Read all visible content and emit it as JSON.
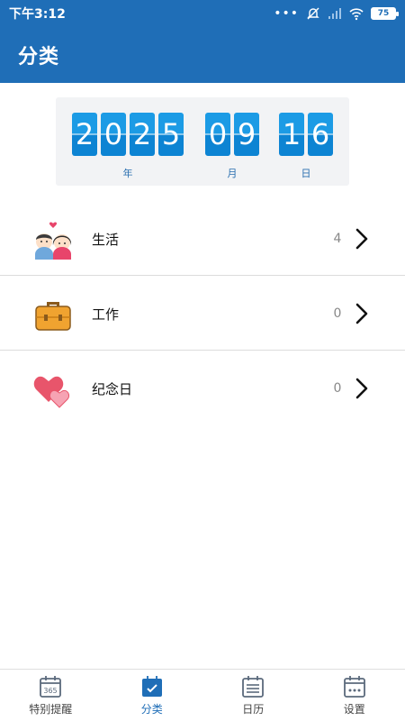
{
  "status_bar": {
    "time": "下午3:12",
    "battery": "75"
  },
  "header": {
    "title": "分类"
  },
  "date": {
    "year": [
      "2",
      "0",
      "2",
      "5"
    ],
    "month": [
      "0",
      "9"
    ],
    "day": [
      "1",
      "6"
    ],
    "year_label": "年",
    "month_label": "月",
    "day_label": "日"
  },
  "categories": [
    {
      "label": "生活",
      "count": "4",
      "icon": "couple-icon"
    },
    {
      "label": "工作",
      "count": "0",
      "icon": "briefcase-icon"
    },
    {
      "label": "纪念日",
      "count": "0",
      "icon": "hearts-icon"
    }
  ],
  "bottom_nav": [
    {
      "label": "特别提醒",
      "icon": "calendar-365-icon",
      "active": false
    },
    {
      "label": "分类",
      "icon": "calendar-check-icon",
      "active": true
    },
    {
      "label": "日历",
      "icon": "calendar-list-icon",
      "active": false
    },
    {
      "label": "设置",
      "icon": "calendar-dots-icon",
      "active": false
    }
  ],
  "colors": {
    "primary": "#1f6eb7",
    "digit": "#1c9be5"
  }
}
